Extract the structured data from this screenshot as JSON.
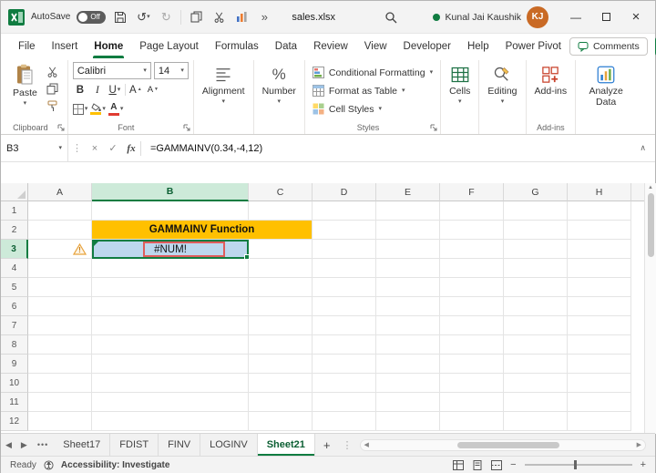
{
  "titlebar": {
    "autosave_label": "AutoSave",
    "autosave_state": "Off",
    "filename": "sales.xlsx",
    "user_name": "Kunal Jai Kaushik",
    "user_initials": "KJ"
  },
  "window": {
    "minimize": "—",
    "close": "×"
  },
  "ribbon_tabs": [
    {
      "label": "File"
    },
    {
      "label": "Insert"
    },
    {
      "label": "Home"
    },
    {
      "label": "Page Layout"
    },
    {
      "label": "Formulas"
    },
    {
      "label": "Data"
    },
    {
      "label": "Review"
    },
    {
      "label": "View"
    },
    {
      "label": "Developer"
    },
    {
      "label": "Help"
    },
    {
      "label": "Power Pivot"
    }
  ],
  "comments_label": "Comments",
  "ribbon": {
    "paste": "Paste",
    "clipboard_group": "Clipboard",
    "font_name": "Calibri",
    "font_size": "14",
    "bold": "B",
    "italic": "I",
    "underline": "U",
    "font_group": "Font",
    "alignment": "Alignment",
    "number": "Number",
    "conditional_formatting": "Conditional Formatting",
    "format_as_table": "Format as Table",
    "cell_styles": "Cell Styles",
    "styles_group": "Styles",
    "cells": "Cells",
    "editing": "Editing",
    "addins": "Add-ins",
    "addins_group": "Add-ins",
    "analyze_data": "Analyze Data"
  },
  "formula_bar": {
    "name_box": "B3",
    "fx": "fx",
    "formula": "=GAMMAINV(0.34,-4,12)"
  },
  "grid": {
    "columns": [
      "A",
      "B",
      "C",
      "D",
      "E",
      "F",
      "G",
      "H"
    ],
    "rows": [
      "1",
      "2",
      "3",
      "4",
      "5",
      "6",
      "7",
      "8",
      "9",
      "10",
      "11",
      "12"
    ],
    "title_text": "GAMMAINV Function",
    "error_text": "#NUM!",
    "warning": "!"
  },
  "sheets": {
    "tabs": [
      {
        "label": "Sheet17"
      },
      {
        "label": "FDIST"
      },
      {
        "label": "FINV"
      },
      {
        "label": "LOGINV"
      },
      {
        "label": "Sheet21"
      }
    ],
    "more": "•••",
    "add": "+"
  },
  "status": {
    "ready": "Ready",
    "accessibility": "Accessibility: Investigate"
  },
  "glyphs": {
    "chevron": "▾",
    "up": "∧",
    "dots": "⋮",
    "undo": "↺",
    "redo": "↻",
    "check": "✓",
    "x": "×",
    "left": "◀",
    "right": "▶",
    "upsm": "▲",
    "dnsm": "▼",
    "minus": "−",
    "plus": "+",
    "a": "A",
    "percent": "%",
    "overflow": "»"
  }
}
